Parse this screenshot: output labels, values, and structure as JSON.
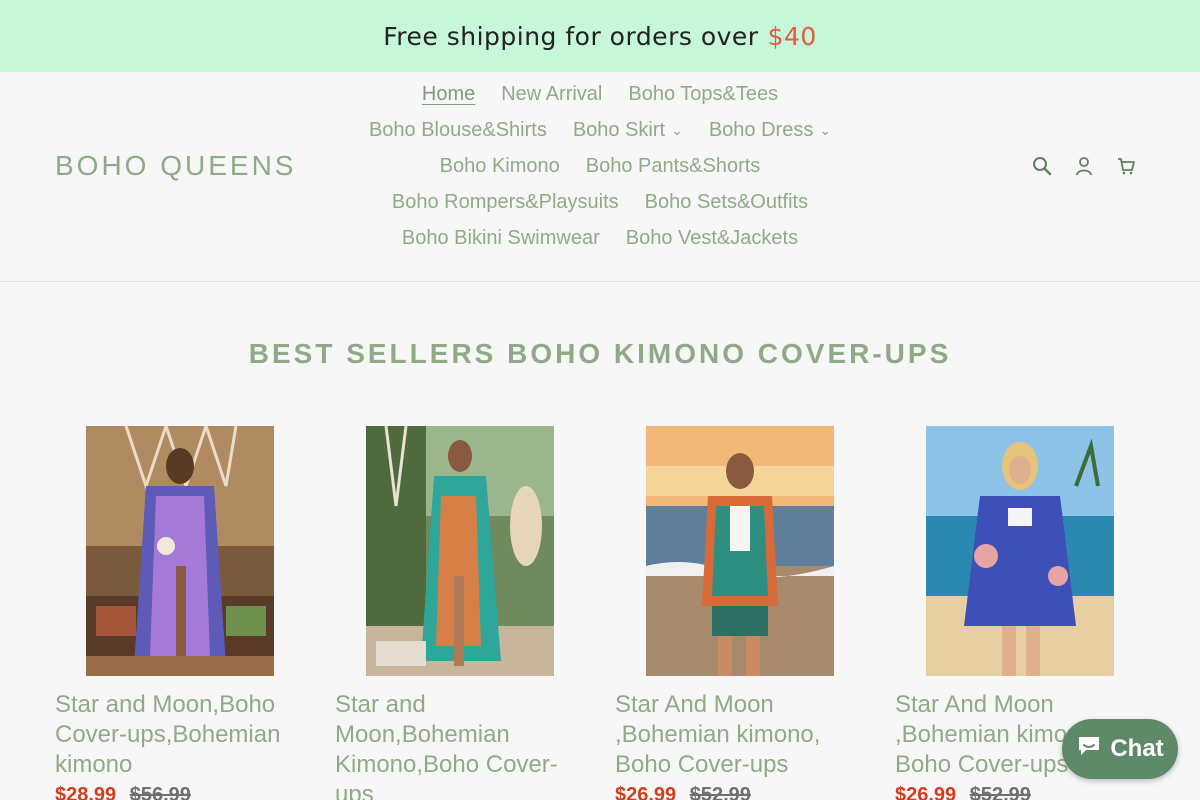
{
  "announcement": {
    "text": "Free shipping for orders over",
    "price": "$40"
  },
  "logo": "BOHO QUEENS",
  "nav": {
    "rows": [
      [
        {
          "label": "Home",
          "active": true
        },
        {
          "label": "New Arrival"
        },
        {
          "label": "Boho Tops&Tees"
        }
      ],
      [
        {
          "label": "Boho Blouse&Shirts"
        },
        {
          "label": "Boho Skirt",
          "dropdown": true
        },
        {
          "label": "Boho Dress",
          "dropdown": true
        }
      ],
      [
        {
          "label": "Boho Kimono"
        },
        {
          "label": "Boho Pants&Shorts"
        }
      ],
      [
        {
          "label": "Boho Rompers&Playsuits"
        },
        {
          "label": "Boho Sets&Outfits"
        }
      ],
      [
        {
          "label": "Boho Bikini Swimwear"
        },
        {
          "label": "Boho Vest&Jackets"
        }
      ]
    ]
  },
  "header_icons": [
    "search-icon",
    "account-icon",
    "cart-icon"
  ],
  "section_title": "BEST SELLERS BOHO KIMONO COVER-UPS",
  "products": [
    {
      "title": "Star and Moon,Boho Cover-ups,Bohemian kimono",
      "sale": "$28.99",
      "compare": "$56.99",
      "image": "woman in purple star and moon kimono in boho room"
    },
    {
      "title": "Star and Moon,Bohemian Kimono,Boho Cover-ups",
      "sale": "",
      "compare": "",
      "image": "woman in teal floral kimono on patio with pampas grass"
    },
    {
      "title": "Star And Moon ,Bohemian kimono, Boho Cover-ups",
      "sale": "$26.99",
      "compare": "$52.99",
      "image": "woman in orange teal kimono set on beach at sunset"
    },
    {
      "title": "Star And Moon ,Bohemian kimono, Boho Cover-ups",
      "sale": "$26.99",
      "compare": "$52.99",
      "image": "woman in blue kimono with bikini on beach"
    }
  ],
  "chat": {
    "label": "Chat"
  },
  "colors": {
    "accent": "#8faa86",
    "announce_bg": "#c6f7d8",
    "sale": "#d23c1f",
    "chat_bg": "#5e8a6a"
  }
}
